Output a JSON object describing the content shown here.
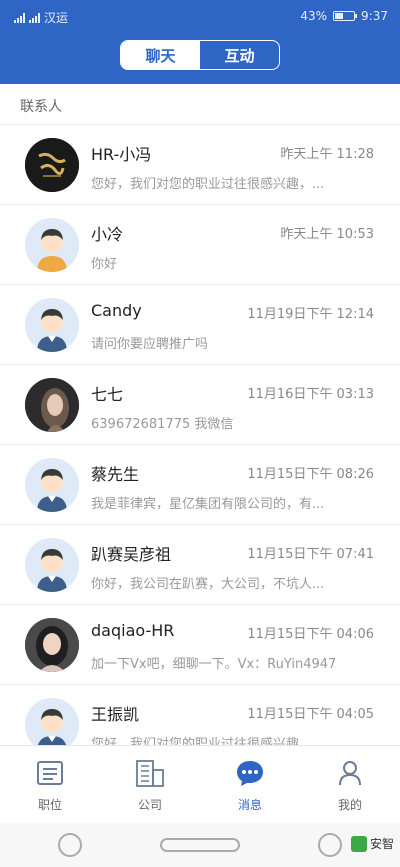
{
  "status_bar": {
    "carrier_left": "汉运",
    "battery": "43%",
    "time": "9:37",
    "battery_level": 0.43
  },
  "tabs": [
    {
      "label": "聊天",
      "active": true
    },
    {
      "label": "互动",
      "active": false
    }
  ],
  "section_label": "联系人",
  "contacts": [
    {
      "name": "HR-小冯",
      "time": "昨天上午 11:28",
      "message": "您好，我们对您的职业过往很感兴趣，...",
      "avatar": "logo-avatar"
    },
    {
      "name": "小冷",
      "time": "昨天上午 10:53",
      "message": "你好",
      "avatar": "default-boy-avatar"
    },
    {
      "name": "Candy",
      "time": "11月19日下午 12:14",
      "message": "请问你要应聘推广吗",
      "avatar": "default-avatar"
    },
    {
      "name": "七七",
      "time": "11月16日下午 03:13",
      "message": "639672681775 我微信",
      "avatar": "photo-avatar"
    },
    {
      "name": "蔡先生",
      "time": "11月15日下午 08:26",
      "message": "我是菲律宾，星亿集团有限公司的，有...",
      "avatar": "default-avatar"
    },
    {
      "name": "趴赛吴彦祖",
      "time": "11月15日下午 07:41",
      "message": "你好，我公司在趴赛，大公司，不坑人...",
      "avatar": "default-avatar"
    },
    {
      "name": "daqiao-HR",
      "time": "11月15日下午 04:06",
      "message": "加一下Vx吧，细聊一下。Vx：RuYin4947",
      "avatar": "photo-avatar"
    },
    {
      "name": "王振凯",
      "time": "11月15日下午 04:05",
      "message": "您好，我们对您的职业过往很感兴趣",
      "avatar": "default-avatar"
    }
  ],
  "bottom_nav": [
    {
      "label": "职位",
      "icon": "job-list-icon",
      "active": false
    },
    {
      "label": "公司",
      "icon": "building-icon",
      "active": false
    },
    {
      "label": "消息",
      "icon": "chat-bubble-icon",
      "active": true
    },
    {
      "label": "我的",
      "icon": "person-icon",
      "active": false
    }
  ],
  "watermark": "安智",
  "colors": {
    "primary": "#2f66c6",
    "text_muted": "#999999"
  }
}
